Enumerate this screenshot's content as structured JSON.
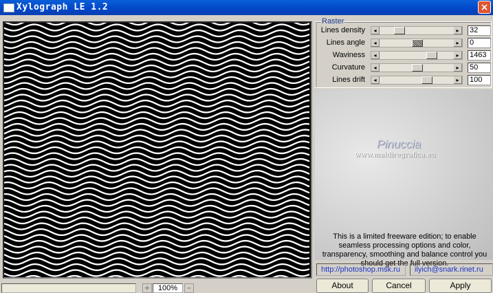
{
  "window": {
    "title": "Xylograph LE 1.2",
    "close_glyph": "×"
  },
  "raster": {
    "legend": "Raster",
    "params": [
      {
        "label": "Lines density",
        "value": "32",
        "level": 0.22
      },
      {
        "label": "Lines angle",
        "value": "0",
        "level": 0.5
      },
      {
        "label": "Waviness",
        "value": "1463",
        "level": 0.72
      },
      {
        "label": "Curvature",
        "value": "50",
        "level": 0.5
      },
      {
        "label": "Lines drift",
        "value": "100",
        "level": 0.65
      }
    ]
  },
  "logo": {
    "brand": "Pinuccia",
    "site": "www.maidiregrafica.eu"
  },
  "notice": "This is a limited freeware edition; to enable seamless processing options and color, transparency, smoothing and balance control you should get the full version.",
  "links": {
    "site": "http://photoshop.msk.ru",
    "email": "ilyich@snark.rinet.ru"
  },
  "buttons": {
    "about": "About",
    "cancel": "Cancel",
    "apply": "Apply"
  },
  "zoom": {
    "value": "100%",
    "minus": "–",
    "plus": "+"
  },
  "colors": {
    "accent": "#0046c7",
    "link": "#1b34c7",
    "preview_bg": "#000000",
    "wave": "#ffffff"
  }
}
